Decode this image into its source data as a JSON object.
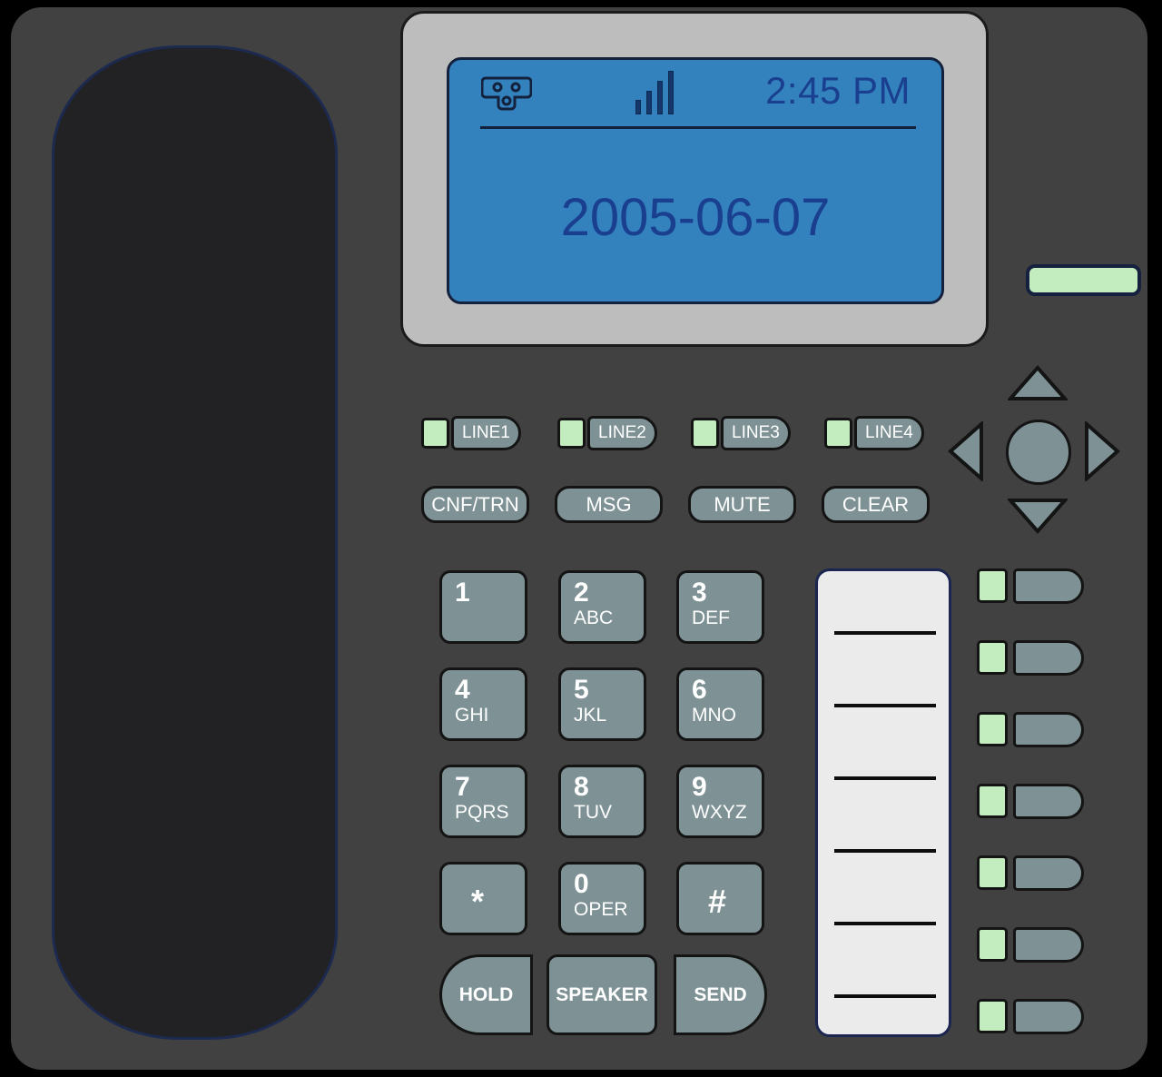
{
  "device": {
    "name": "VoIP Desk Phone",
    "body_color": "#414141",
    "key_color": "#7e9295",
    "led_color": "#c3edbe",
    "lcd_color": "#3382be",
    "lcd_text_color": "#1a3f8f",
    "bezel_color": "#bdbdbd"
  },
  "handset": {
    "label": "handset",
    "color": "#222225",
    "outline": "#1d2a50"
  },
  "display": {
    "status": {
      "power_icon": "power-plug-icon",
      "signal_icon": "signal-bars-icon",
      "signal_bars": 4,
      "time": "2:45 PM"
    },
    "date": "2005-06-07"
  },
  "green_indicator": {
    "label": "",
    "color": "#c3edbe"
  },
  "line_keys": [
    {
      "label": "LINE1",
      "led": "on"
    },
    {
      "label": "LINE2",
      "led": "on"
    },
    {
      "label": "LINE3",
      "led": "on"
    },
    {
      "label": "LINE4",
      "led": "on"
    }
  ],
  "function_keys": [
    {
      "label": "CNF/TRN"
    },
    {
      "label": "MSG"
    },
    {
      "label": "MUTE"
    },
    {
      "label": "CLEAR"
    }
  ],
  "navigation": {
    "up": "nav-up",
    "down": "nav-down",
    "left": "nav-left",
    "right": "nav-right",
    "select": "nav-select"
  },
  "keypad": [
    {
      "digit": "1",
      "letters": ""
    },
    {
      "digit": "2",
      "letters": "ABC"
    },
    {
      "digit": "3",
      "letters": "DEF"
    },
    {
      "digit": "4",
      "letters": "GHI"
    },
    {
      "digit": "5",
      "letters": "JKL"
    },
    {
      "digit": "6",
      "letters": "MNO"
    },
    {
      "digit": "7",
      "letters": "PQRS"
    },
    {
      "digit": "8",
      "letters": "TUV"
    },
    {
      "digit": "9",
      "letters": "WXYZ"
    },
    {
      "digit": "*",
      "letters": ""
    },
    {
      "digit": "0",
      "letters": "OPER"
    },
    {
      "digit": "#",
      "letters": ""
    }
  ],
  "action_keys": [
    {
      "label": "HOLD"
    },
    {
      "label": "SPEAKER"
    },
    {
      "label": "SEND"
    }
  ],
  "label_strip": {
    "entries": [
      "",
      "",
      "",
      "",
      "",
      "",
      ""
    ],
    "divider_count": 6
  },
  "programmable_keys": [
    {
      "label": "",
      "led": "on"
    },
    {
      "label": "",
      "led": "on"
    },
    {
      "label": "",
      "led": "on"
    },
    {
      "label": "",
      "led": "on"
    },
    {
      "label": "",
      "led": "on"
    },
    {
      "label": "",
      "led": "on"
    },
    {
      "label": "",
      "led": "on"
    }
  ]
}
